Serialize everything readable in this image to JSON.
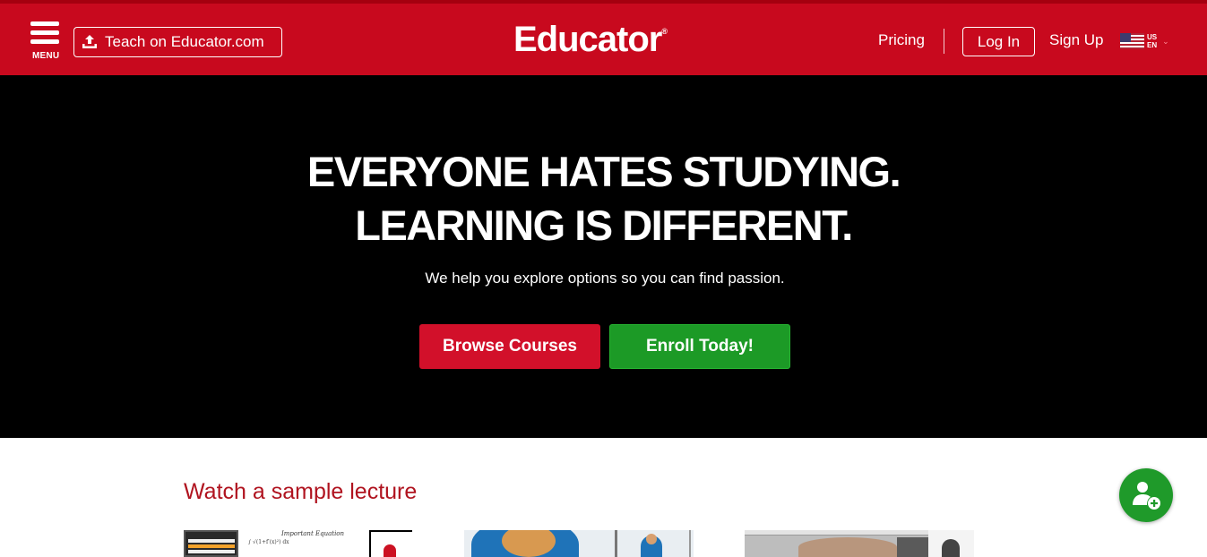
{
  "header": {
    "menu_label": "MENU",
    "teach_label": "Teach on Educator.com",
    "logo_text": "Educator",
    "logo_mark": "®",
    "nav": {
      "pricing": "Pricing",
      "login": "Log In",
      "signup": "Sign Up"
    },
    "locale": {
      "country": "US",
      "language": "EN"
    },
    "colors": {
      "brand_red": "#c8091e"
    }
  },
  "hero": {
    "title_line1": "EVERYONE HATES STUDYING.",
    "title_line2": "LEARNING IS DIFFERENT.",
    "subtitle": "We help you explore options so you can find passion.",
    "browse_label": "Browse Courses",
    "enroll_label": "Enroll Today!",
    "colors": {
      "browse_bg": "#d2102a",
      "enroll_bg": "#1c9a26"
    }
  },
  "samples": {
    "title": "Watch a sample lecture",
    "thumb1": {
      "equation_title": "Important Equation"
    }
  },
  "icons": {
    "menu": "hamburger-icon",
    "teach": "upload-icon",
    "locale_flag": "us-flag-icon",
    "locale_dropdown": "chevron-down-icon",
    "fab": "add-user-icon"
  }
}
